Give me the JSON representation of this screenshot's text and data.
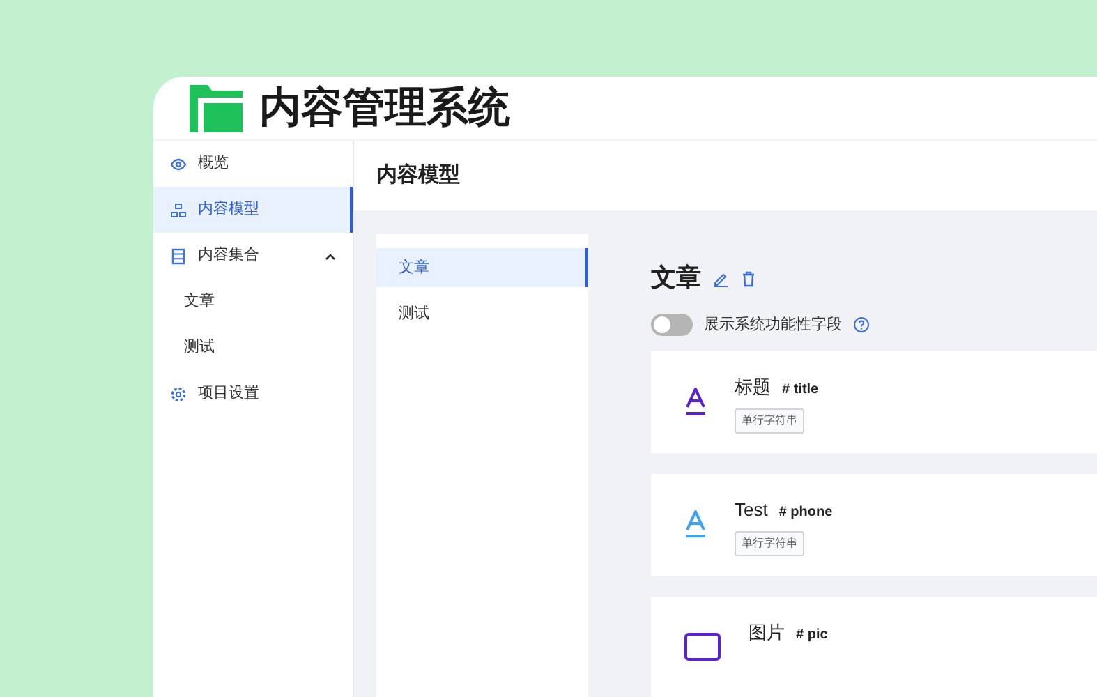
{
  "app": {
    "title": "内容管理系统"
  },
  "sidebar": {
    "items": [
      {
        "label": "概览",
        "kind": "eye",
        "selected": false
      },
      {
        "label": "内容模型",
        "kind": "model",
        "selected": true
      },
      {
        "label": "内容集合",
        "kind": "list",
        "selected": false,
        "expanded": true,
        "children": [
          {
            "label": "文章",
            "selected": false
          },
          {
            "label": "测试",
            "selected": false
          }
        ]
      },
      {
        "label": "项目设置",
        "kind": "gear",
        "selected": false
      }
    ]
  },
  "page": {
    "title": "内容模型"
  },
  "models": [
    {
      "label": "文章",
      "selected": true
    },
    {
      "label": "测试",
      "selected": false
    }
  ],
  "model": {
    "title": "文章",
    "toggle": {
      "label": "展示系统功能性字段",
      "on": false
    },
    "fields": [
      {
        "kind": "text",
        "name": "标题",
        "key": "# title",
        "tag": "单行字符串",
        "color": "#5b21d6"
      },
      {
        "kind": "text",
        "name": "Test",
        "key": "# phone",
        "tag": "单行字符串",
        "color": "#3fa3f5"
      },
      {
        "kind": "image",
        "name": "图片",
        "key": "# pic",
        "color": "#5b21d6"
      }
    ]
  }
}
